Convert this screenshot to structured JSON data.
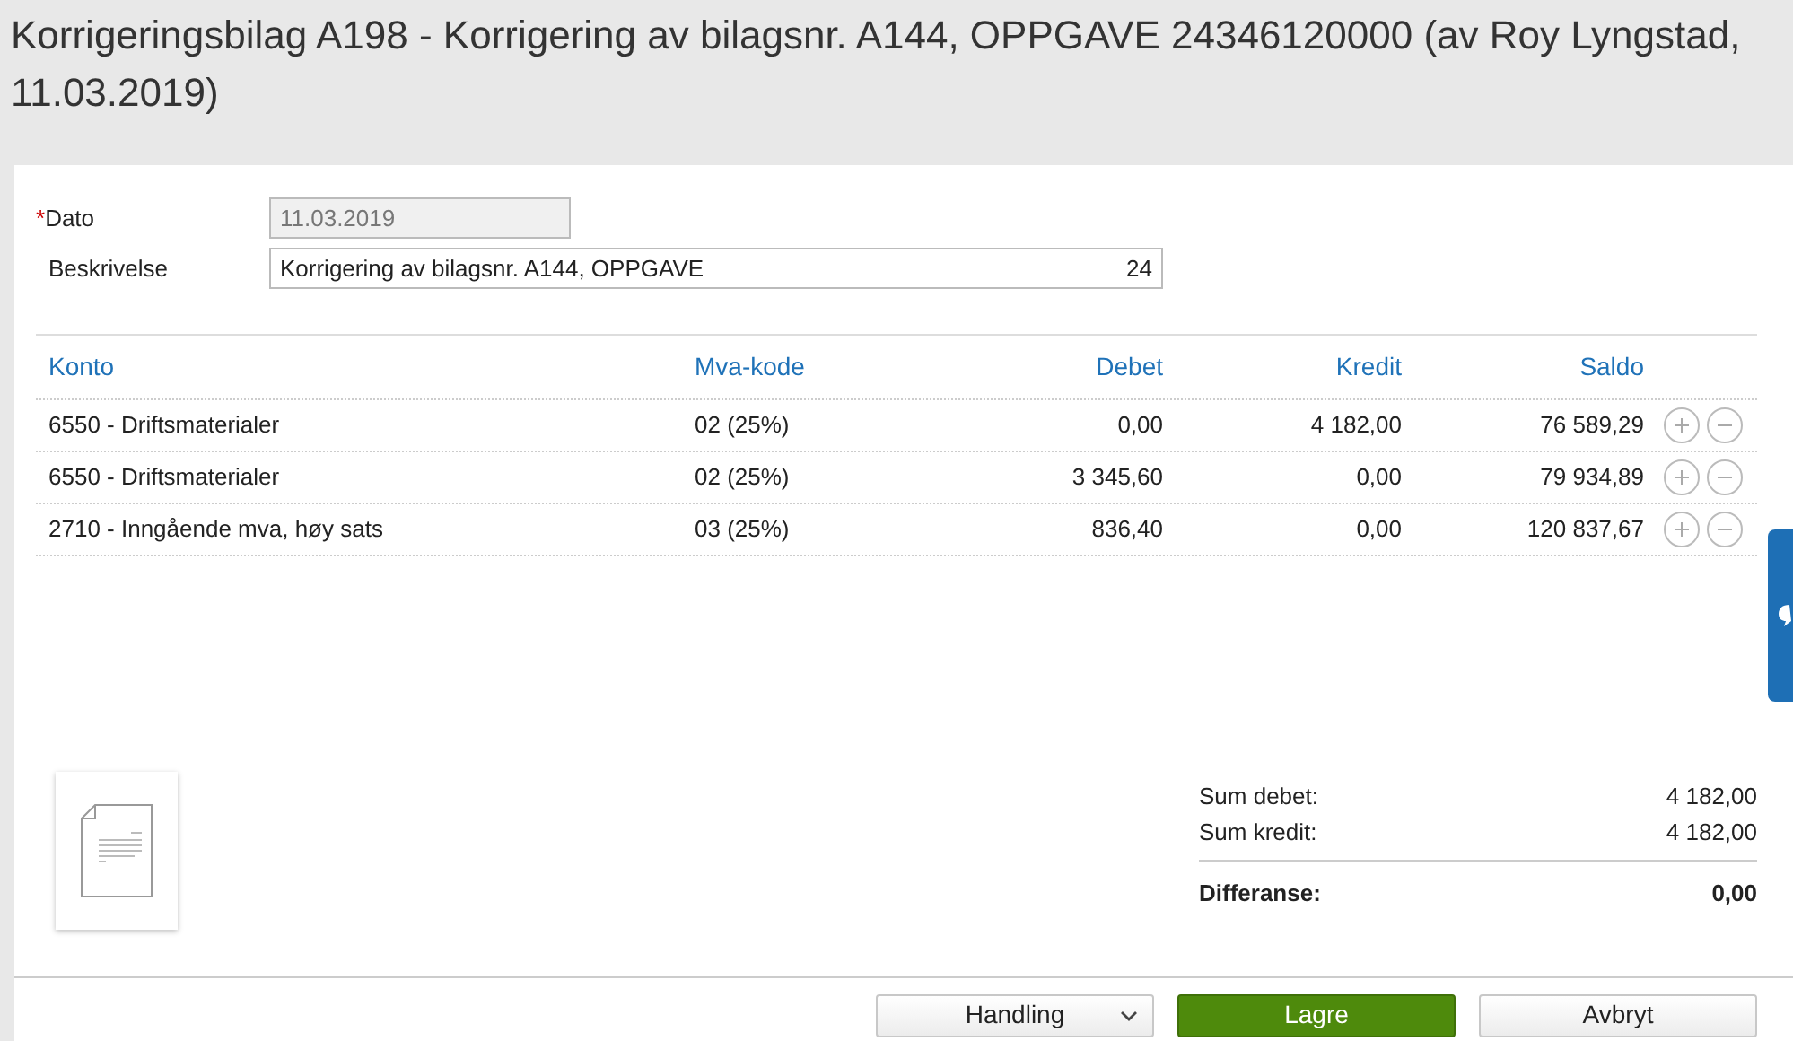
{
  "title": "Korrigeringsbilag A198  -  Korrigering av bilagsnr. A144, OPPGAVE 24346120000 (av Roy Lyngstad, 11.03.2019)",
  "fields": [
    {
      "label": "Dato",
      "required": true,
      "disabled": true,
      "value": "11.03.2019",
      "required_mark": "*"
    },
    {
      "label": "Beskrivelse",
      "required": false,
      "disabled": false,
      "value": "Korrigering av bilagsnr. A144, OPPGAVE",
      "value_end": "24"
    }
  ],
  "table": {
    "columns": [
      "Konto",
      "Mva-kode",
      "Debet",
      "Kredit",
      "Saldo"
    ],
    "rows": [
      [
        "6550 - Driftsmaterialer",
        "02 (25%)",
        "0,00",
        "4 182,00",
        "76 589,29"
      ],
      [
        "6550 - Driftsmaterialer",
        "02 (25%)",
        "3 345,60",
        "0,00",
        "79 934,89"
      ],
      [
        "2710 - Inngående mva, høy sats",
        "03 (25%)",
        "836,40",
        "0,00",
        "120 837,67"
      ]
    ]
  },
  "totals": [
    {
      "label": "Sum debet:",
      "value": "4 182,00",
      "bold": false
    },
    {
      "label": "Sum kredit:",
      "value": "4 182,00",
      "bold": false
    },
    {
      "label": "Differanse:",
      "value": "0,00",
      "bold": true
    }
  ],
  "buttons": [
    {
      "label": "Handling",
      "kind": "dropdown"
    },
    {
      "label": "Lagre",
      "kind": "primary"
    },
    {
      "label": "Avbryt",
      "kind": "default"
    }
  ]
}
